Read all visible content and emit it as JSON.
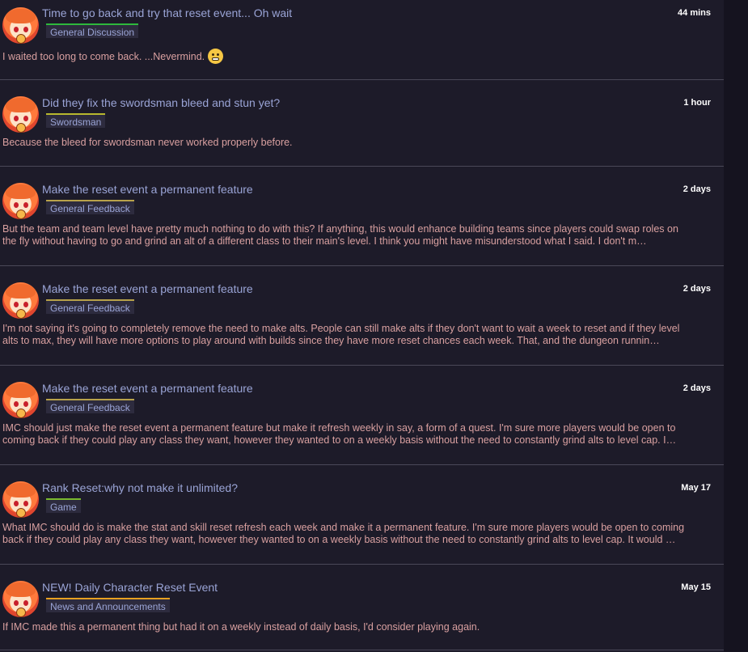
{
  "posts": [
    {
      "title": "Time to go back and try that reset event... Oh wait",
      "category": "General Discussion",
      "category_color": "#2eb83c",
      "time": "44 mins",
      "line1": "I waited too long to come back. ...Nevermind.",
      "line2": ""
    },
    {
      "title": "Did they fix the swordsman bleed and stun yet?",
      "category": "Swordsman",
      "category_color": "#b8b82e",
      "time": "1 hour",
      "line1": "Because the bleed for swordsman never worked properly before.",
      "line2": ""
    },
    {
      "title": "Make the reset event a permanent feature",
      "category": "General Feedback",
      "category_color": "#b8a24a",
      "time": "2 days",
      "line1": "But the team and team level have pretty much nothing to do with this? If anything, this would enhance building teams since players could swap roles on",
      "line2": "the fly without having to go and grind an alt of a different class to their main's level. I think you might have misunderstood what I said. I don't m…"
    },
    {
      "title": "Make the reset event a permanent feature",
      "category": "General Feedback",
      "category_color": "#b8a24a",
      "time": "2 days",
      "line1": "I'm not saying it's going to completely remove the need to make alts. People can still make alts if they don't want to wait a week to reset and if they level",
      "line2": "alts to max, they will have more options to play around with builds since they have more reset chances each week. That, and the dungeon runnin…"
    },
    {
      "title": "Make the reset event a permanent feature",
      "category": "General Feedback",
      "category_color": "#b8a24a",
      "time": "2 days",
      "line1": "IMC should just make the reset event a permanent feature but make it refresh weekly in say, a form of a quest. I'm sure more players would be open to",
      "line2": "coming back if they could play any class they want, however they wanted to on a weekly basis without the need to constantly grind alts to level cap. I…"
    },
    {
      "title": "Rank Reset:why not make it unlimited?",
      "category": "Game",
      "category_color": "#7ab82e",
      "time": "May 17",
      "line1": "What IMC should do is make the stat and skill reset refresh each week and make it a permanent feature. I'm sure more players would be open to coming",
      "line2": "back if they could play any class they want, however they wanted to on a weekly basis without the need to constantly grind alts to level cap. It would …"
    },
    {
      "title": "NEW! Daily Character Reset Event",
      "category": "News and Announcements",
      "category_color": "#e8a020",
      "time": "May 15",
      "line1": "If IMC made this a permanent thing but had it on a weekly instead of daily basis, I'd consider playing again.",
      "line2": ""
    }
  ]
}
